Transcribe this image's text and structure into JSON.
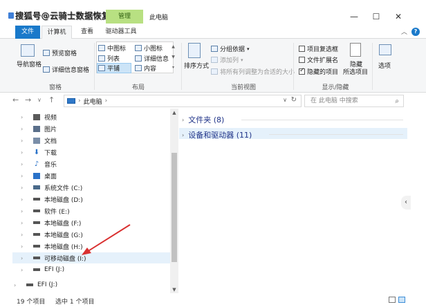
{
  "titlebar": {
    "watermark": "搜狐号@云骑士数据恢复",
    "manage_tab": "管理",
    "title": "此电脑",
    "minimize": "—",
    "maximize": "☐",
    "close": "✕"
  },
  "tabs": {
    "file": "文件",
    "computer": "计算机",
    "view": "查看",
    "drive_tools": "驱动器工具"
  },
  "ribbon": {
    "panes": {
      "preview_pane": "预览窗格",
      "nav_pane": "导航窗格",
      "details_pane": "详细信息窗格",
      "label": "窗格"
    },
    "layout": {
      "medium_icons": "中图标",
      "small_icons": "小图标",
      "list": "列表",
      "details": "详细信息",
      "tiles": "平铺",
      "content": "内容",
      "label": "布局"
    },
    "current_view": {
      "sort_by": "排序方式",
      "group_by": "分组依据",
      "add_columns": "添加列",
      "size_all_columns": "将所有列调整为合适的大小",
      "label": "当前视图"
    },
    "show_hide": {
      "item_checkboxes": "项目复选框",
      "file_extensions": "文件扩展名",
      "hidden_items": "隐藏的项目",
      "hide_selected": "隐藏",
      "selected_items": "所选项目",
      "label": "显示/隐藏"
    },
    "options": "选项"
  },
  "address": {
    "path_root": "此电脑",
    "search_placeholder": "在 此电脑 中搜索"
  },
  "nav": {
    "items": [
      {
        "label": "视频",
        "icon": "video-icon",
        "color": "#5a5a5a"
      },
      {
        "label": "图片",
        "icon": "pictures-icon",
        "color": "#5a6f8a"
      },
      {
        "label": "文档",
        "icon": "documents-icon",
        "color": "#7a8ea8"
      },
      {
        "label": "下载",
        "icon": "downloads-icon",
        "color": "#2a72c9"
      },
      {
        "label": "音乐",
        "icon": "music-icon",
        "color": "#2a72c9"
      },
      {
        "label": "桌面",
        "icon": "desktop-icon",
        "color": "#2a72c9"
      },
      {
        "label": "系统文件 (C:)",
        "icon": "system-drive-icon",
        "color": "#4a6a8a"
      },
      {
        "label": "本地磁盘 (D:)",
        "icon": "drive-icon",
        "color": "#555555"
      },
      {
        "label": "软件 (E:)",
        "icon": "drive-icon",
        "color": "#555555"
      },
      {
        "label": "本地磁盘 (F:)",
        "icon": "drive-icon",
        "color": "#555555"
      },
      {
        "label": "本地磁盘 (G:)",
        "icon": "drive-icon",
        "color": "#555555"
      },
      {
        "label": "本地磁盘 (H:)",
        "icon": "drive-icon",
        "color": "#555555"
      },
      {
        "label": "可移动磁盘 (I:)",
        "icon": "removable-drive-icon",
        "color": "#555555"
      },
      {
        "label": "EFI (J:)",
        "icon": "drive-icon",
        "color": "#555555"
      }
    ],
    "efi_root": "EFI (J:)"
  },
  "content": {
    "folders_group": "文件夹 (8)",
    "devices_group": "设备和驱动器 (11)"
  },
  "status": {
    "item_count": "19 个项目",
    "selected": "选中 1 个项目"
  },
  "colors": {
    "file_tab": "#1979ca",
    "manage_tab": "#b8e082",
    "selection": "#e5f1fb",
    "annotation_arrow": "#d93030"
  }
}
